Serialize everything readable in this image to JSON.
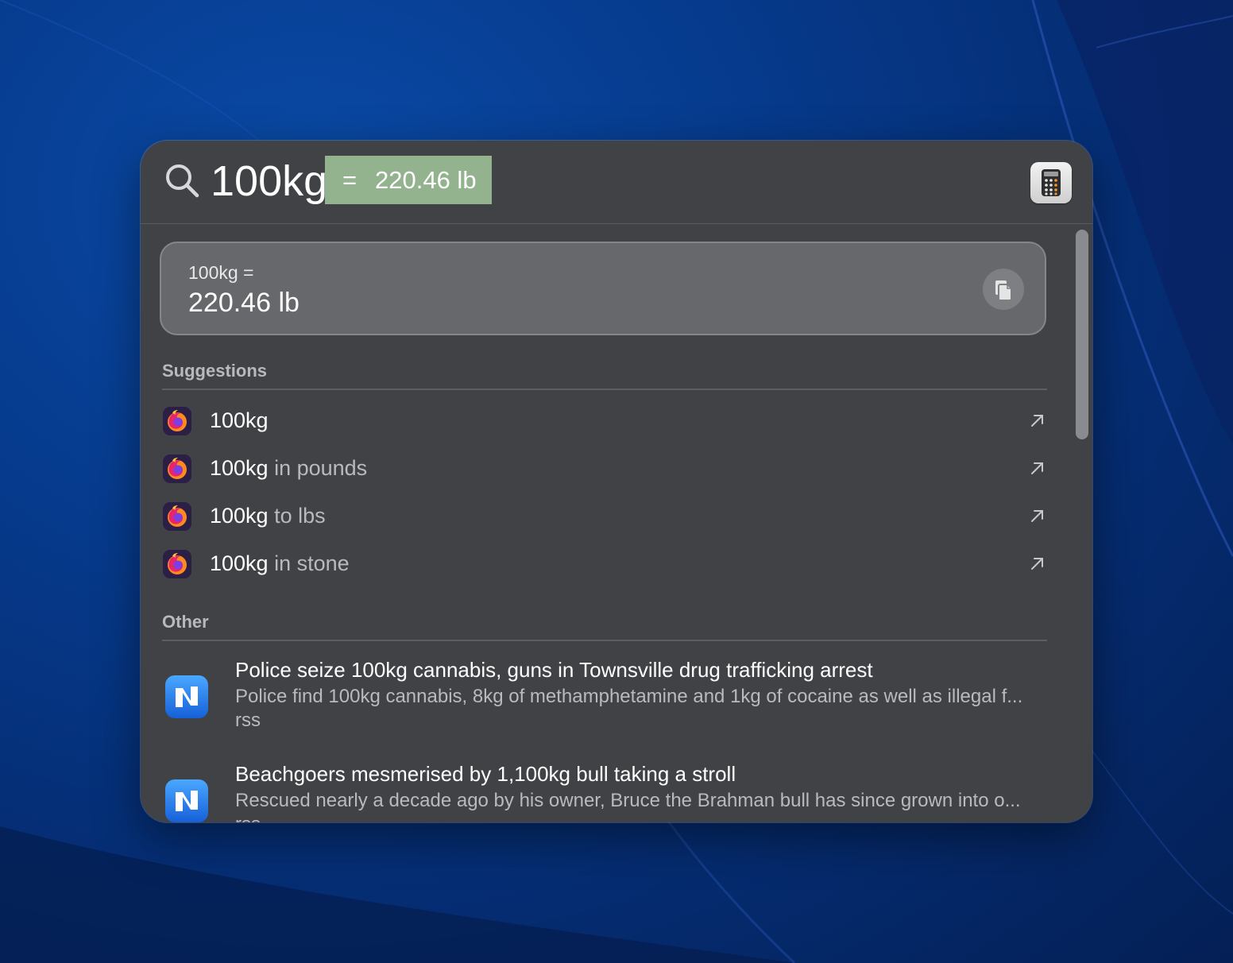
{
  "search": {
    "query": "100kg",
    "inline_equals": "=",
    "inline_result": "220.46 lb"
  },
  "calculator": {
    "expression": "100kg =",
    "answer": "220.46 lb"
  },
  "suggestions": {
    "title": "Suggestions",
    "items": [
      {
        "bold": "100kg",
        "rest": ""
      },
      {
        "bold": "100kg",
        "rest": " in pounds"
      },
      {
        "bold": "100kg",
        "rest": " to lbs"
      },
      {
        "bold": "100kg",
        "rest": " in stone"
      }
    ]
  },
  "other": {
    "title": "Other",
    "items": [
      {
        "title": "Police seize 100kg cannabis, guns in Townsville drug trafficking arrest",
        "description": "Police find 100kg cannabis, 8kg of methamphetamine and 1kg of cocaine as well as illegal f...",
        "source": "rss"
      },
      {
        "title": "Beachgoers mesmerised by 1,100kg bull taking a stroll",
        "description": "Rescued nearly a decade ago by his owner, Bruce the Brahman bull has since grown into o...",
        "source": "rss"
      }
    ]
  },
  "colors": {
    "panel": "#414246",
    "inline_highlight": "#93b38f",
    "calc_card": "#67686c"
  }
}
